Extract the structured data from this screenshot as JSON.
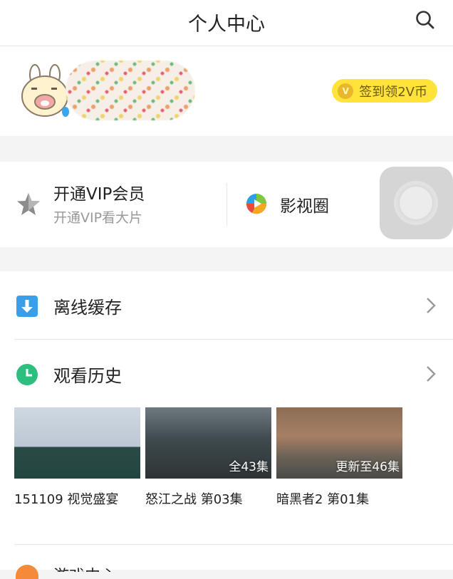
{
  "header": {
    "title": "个人中心"
  },
  "profile": {
    "checkin_label": "签到领2V币",
    "coin_letter": "V"
  },
  "vip": {
    "title": "开通VIP会员",
    "subtitle": "开通VIP看大片"
  },
  "circle": {
    "label": "影视圈"
  },
  "menu": {
    "offline": "离线缓存",
    "history": "观看历史"
  },
  "history": [
    {
      "title": "151109 视觉盛宴",
      "badge": ""
    },
    {
      "title": "怒江之战 第03集",
      "badge": "全43集"
    },
    {
      "title": "暗黑者2 第01集",
      "badge": "更新至46集"
    }
  ],
  "bottom_partial_text": "游戏中心",
  "colors": {
    "accent_yellow": "#ffe23a",
    "offline_blue": "#3a9ee8",
    "history_green": "#2dbf7e",
    "bottom_orange": "#f58a3a"
  }
}
